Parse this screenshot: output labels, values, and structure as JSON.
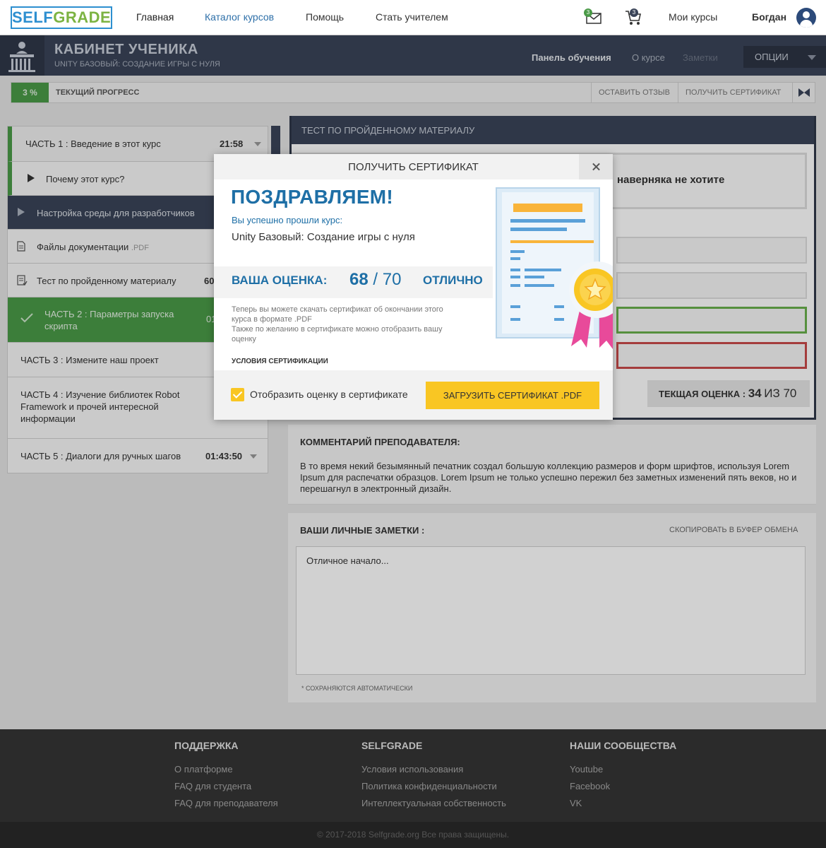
{
  "nav": {
    "logo_self": "SELF",
    "logo_grade": "GRADE",
    "home": "Главная",
    "catalog": "Каталог курсов",
    "help": "Помощь",
    "become_teacher": "Стать учителем",
    "mail_badge": "3",
    "cart_badge": "3",
    "my_courses": "Мои курсы",
    "user_name": "Богдан"
  },
  "header": {
    "title": "КАБИНЕТ УЧЕНИКА",
    "subtitle": "UNITY БАЗОВЫЙ: СОЗДАНИЕ ИГРЫ С НУЛЯ",
    "tab_dashboard": "Панель обучения",
    "tab_about": "О курсе",
    "tab_notes": "Заметки",
    "options": "ОПЦИИ"
  },
  "progress": {
    "percent": "3 %",
    "percent_value": 3,
    "label": "ТЕКУЩИЙ ПРОГРЕСС",
    "review_button": "ОСТАВИТЬ ОТЗЫВ",
    "certificate_button": "ПОЛУЧИТЬ СЕРТИФИКАТ"
  },
  "sidebar": {
    "part1": "ЧАСТЬ 1 : Введение в этот курс",
    "part1_time": "21:58",
    "lesson_why": "Почему этот курс?",
    "lesson_env": "Настройка среды для разработчиков",
    "lesson_docs": "Файлы документации",
    "lesson_docs_ext": ".PDF",
    "lesson_test": "Тест по пройденному материалу",
    "lesson_test_time": "60",
    "part2": "ЧАСТЬ 2 : Параметры запуска скрипта",
    "part2_time": "01",
    "part3": "ЧАСТЬ 3 : Измените наш проект",
    "part4": "ЧАСТЬ 4 : Изучение библиотек Robot Framework и прочей интересной информации",
    "part5": "ЧАСТЬ 5 : Диалоги для ручных шагов",
    "part5_time": "01:43:50"
  },
  "test": {
    "header": "ТЕСТ ПО ПРОЙДЕННОМУ МАТЕРИАЛУ",
    "question_fragment": "наверняка не хотите",
    "current_grade_label": "ТЕКЩАЯ ОЦЕНКА :",
    "current_grade_value": "34",
    "current_grade_of": "ИЗ 70"
  },
  "comment": {
    "title": "КОММЕНТАРИЙ ПРЕПОДАВАТЕЛЯ:",
    "text": "В то время некий безымянный печатник создал большую коллекцию размеров и форм шрифтов, используя Lorem Ipsum для распечатки образцов. Lorem Ipsum не только успешно пережил без заметных изменений пять веков, но и перешагнул в электронный дизайн."
  },
  "notes": {
    "title": "ВАШИ ЛИЧНЫЕ ЗАМЕТКИ :",
    "copy": "СКОПИРОВАТЬ В БУФЕР ОБМЕНА",
    "value": "Отличное начало...",
    "autosave": "* СОХРАНЯЮТСЯ АВТОМАТИЧЕСКИ"
  },
  "modal": {
    "title": "ПОЛУЧИТЬ СЕРТИФИКАТ",
    "congrats": "ПОЗДРАВЛЯЕМ!",
    "passed": "Вы успешно прошли курс:",
    "course": "Unity Базовый: Создание игры с нуля",
    "score_label": "ВАША ОЦЕНКА:",
    "score": "68",
    "score_sep": " / ",
    "score_max": "70",
    "grade": "ОТЛИЧНО",
    "desc1": "Теперь вы можете скачать сертификат об окончании этого курса в формате .PDF",
    "desc2": "Также по желанию в сертификате можно отобразить вашу оценку",
    "terms": "УСЛОВИЯ СЕРТИФИКАЦИИ",
    "show_grade": "Отобразить оценку в сертификате",
    "show_grade_checked": true,
    "download": "ЗАГРУЗИТЬ СЕРТИФИКАТ .PDF"
  },
  "footer": {
    "support_title": "ПОДДЕРЖКА",
    "support_items": [
      "О платформе",
      "FAQ для студента",
      "FAQ для преподавателя"
    ],
    "selfgrade_title": "SELFGRADE",
    "selfgrade_items": [
      "Условия использования",
      "Политика конфиденциальности",
      "Интеллектуальная собственность"
    ],
    "community_title": "НАШИ СООБЩЕСТВА",
    "community_items": [
      "Youtube",
      "Facebook",
      "VK"
    ],
    "copyright": "© 2017-2018 Selfgrade.org Все права защищены."
  },
  "colors": {
    "accent_blue": "#1e6fa6",
    "header_dark": "#3a4458",
    "progress_green": "#4a9a47",
    "button_yellow": "#f9c623"
  },
  "icons": [
    "mail-icon",
    "cart-icon",
    "user-icon",
    "student-desk-icon",
    "certificate-icon",
    "play-icon",
    "document-icon",
    "test-icon",
    "check-icon",
    "close-icon"
  ]
}
